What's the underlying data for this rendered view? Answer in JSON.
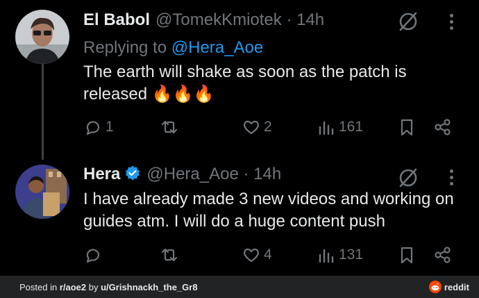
{
  "tweets": [
    {
      "name": "El Babol",
      "handle": "@TomekKmiotek",
      "time": "· 14h",
      "replying_prefix": "Replying to",
      "replying_to": "@Hera_Aoe",
      "text": "The earth will shake as soon as the patch is released 🔥🔥🔥",
      "replies": "1",
      "retweets": "",
      "likes": "2",
      "views": "161"
    },
    {
      "name": "Hera",
      "handle": "@Hera_Aoe",
      "time": "· 14h",
      "text": "I have already made 3 new videos and working on guides atm. I will do a huge content push",
      "replies": "",
      "retweets": "",
      "likes": "4",
      "views": "131"
    }
  ],
  "footer": {
    "posted_in_prefix": "Posted in ",
    "subreddit": "r/aoe2",
    "by_prefix": " by ",
    "user": "u/Grishnackh_the_Gr8",
    "brand": "reddit"
  },
  "colors": {
    "link": "#1d9bf0",
    "muted": "#71767b",
    "verified": "#1d9bf0",
    "fire": "#ff6a00",
    "reddit": "#ff4500"
  }
}
